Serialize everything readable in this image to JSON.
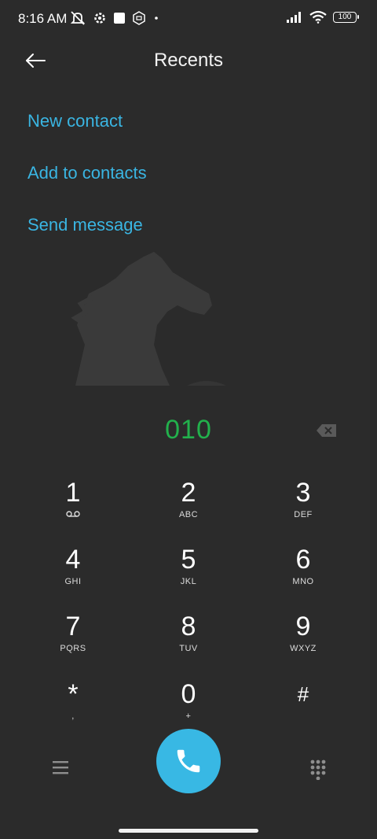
{
  "status_bar": {
    "time": "8:16 AM",
    "battery": "100",
    "left_icons": [
      "mute-icon",
      "settings-icon",
      "square-icon",
      "app-icon",
      "dot-icon"
    ],
    "right_icons": [
      "signal-icon",
      "wifi-icon",
      "battery-icon"
    ]
  },
  "header": {
    "title": "Recents"
  },
  "actions": {
    "new_contact": "New contact",
    "add_to_contacts": "Add to contacts",
    "send_message": "Send message"
  },
  "dialer": {
    "number": "010",
    "number_color": "#22b14c"
  },
  "keypad": [
    {
      "digit": "1",
      "letters": ""
    },
    {
      "digit": "2",
      "letters": "ABC"
    },
    {
      "digit": "3",
      "letters": "DEF"
    },
    {
      "digit": "4",
      "letters": "GHI"
    },
    {
      "digit": "5",
      "letters": "JKL"
    },
    {
      "digit": "6",
      "letters": "MNO"
    },
    {
      "digit": "7",
      "letters": "PQRS"
    },
    {
      "digit": "8",
      "letters": "TUV"
    },
    {
      "digit": "9",
      "letters": "WXYZ"
    },
    {
      "digit": "*",
      "letters": ","
    },
    {
      "digit": "0",
      "letters": "+"
    },
    {
      "digit": "#",
      "letters": ""
    }
  ],
  "colors": {
    "background": "#2b2b2b",
    "accent": "#3ab5e2",
    "call_button": "#38b8e4"
  }
}
